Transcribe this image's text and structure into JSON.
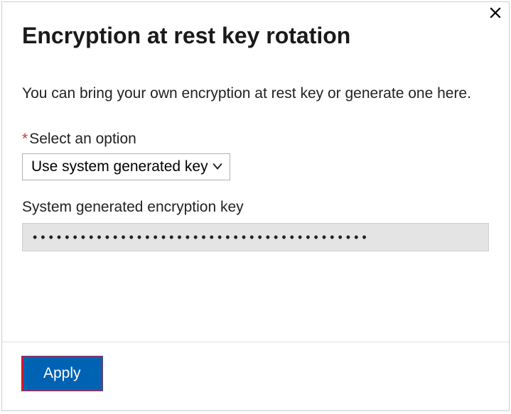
{
  "dialog": {
    "title": "Encryption at rest key rotation",
    "description": "You can bring your own encryption at rest key or generate one here.",
    "option": {
      "label": "Select an option",
      "required_marker": "*",
      "selected": "Use system generated key"
    },
    "key": {
      "label": "System generated encryption key",
      "masked_value": "••••••••••••••••••••••••••••••••••••••••••"
    }
  },
  "actions": {
    "apply_label": "Apply"
  }
}
